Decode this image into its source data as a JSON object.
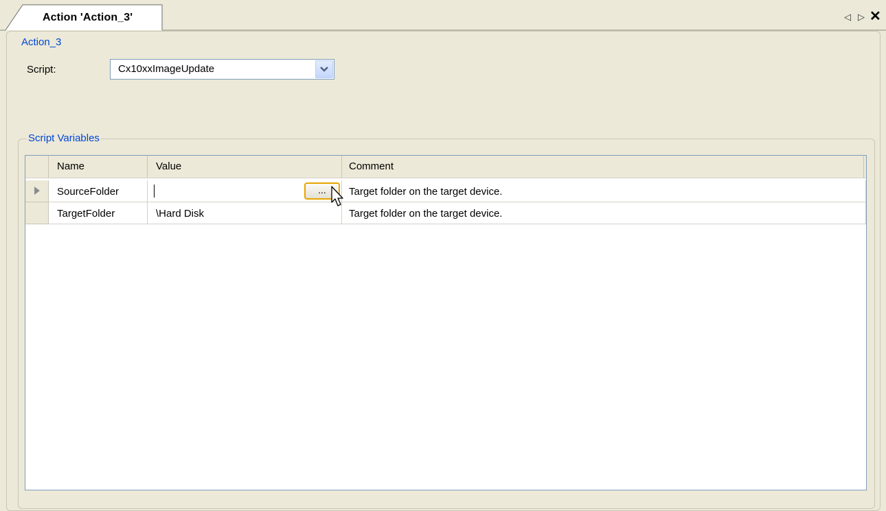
{
  "tab": {
    "title": "Action 'Action_3'",
    "prev_icon": "◁",
    "next_icon": "▷",
    "close_icon": "✕"
  },
  "action_group": {
    "title": "Action_3",
    "script_label": "Script:",
    "script_value": "Cx10xxImageUpdate"
  },
  "variables_group": {
    "title": "Script Variables"
  },
  "grid": {
    "columns": [
      "Name",
      "Value",
      "Comment"
    ],
    "rows": [
      {
        "name": "SourceFolder",
        "value": "",
        "comment": "Target folder on the target device.",
        "current": true
      },
      {
        "name": "TargetFolder",
        "value": "\\Hard Disk",
        "comment": "Target folder on the target device.",
        "current": false
      }
    ],
    "browse_label": "..."
  },
  "colors": {
    "background": "#ece9d8",
    "group_title": "#0046d5",
    "grid_border": "#7f9db9",
    "ellipsis_highlight": "#e8a400"
  }
}
